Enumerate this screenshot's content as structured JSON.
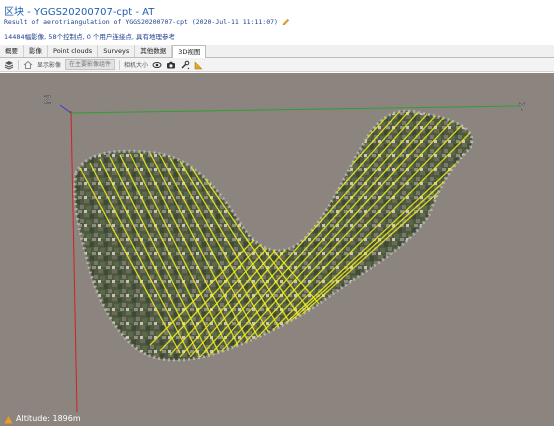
{
  "header": {
    "title": "区块 - YGGS20200707-cpt - AT",
    "subtitle": "Result of aerotriangulation of YGGS20200707-cpt (2020-Jul-11 11:11:07)",
    "summary": "14484幅影像, 58个控制点, 0 个用户连接点, 具有地理参考"
  },
  "tabs": [
    {
      "label": "概要",
      "active": false
    },
    {
      "label": "影像",
      "active": false
    },
    {
      "label": "Point clouds",
      "active": false
    },
    {
      "label": "Surveys",
      "active": false
    },
    {
      "label": "其他数据",
      "active": false
    },
    {
      "label": "3D视图",
      "active": true
    }
  ],
  "toolbar": {
    "show_images_label": "显示影像",
    "select_value": "在主要影像组件",
    "camera_size_label": "相机大小",
    "icons": [
      "layers-icon",
      "home-icon",
      "eye-icon",
      "camera-icon",
      "tool-icon",
      "ruler-icon"
    ]
  },
  "viewport": {
    "axis_z_label": "Z",
    "axis_y_label": "Y",
    "colors": {
      "background": "#8b847f",
      "z_axis": "#d62020",
      "y_axis": "#2ea02e",
      "flight_lines": "#f5f020"
    }
  },
  "status": {
    "altitude_text": "Altitude: 1896m"
  }
}
